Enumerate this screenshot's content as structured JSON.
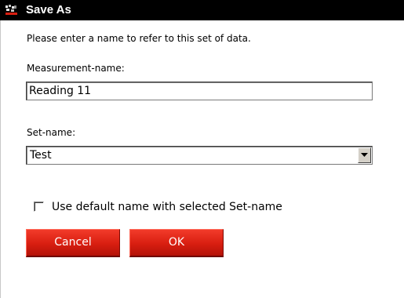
{
  "window": {
    "title": "Save As"
  },
  "dialog": {
    "instruction": "Please enter a name to refer to this set of data.",
    "measurement_label": "Measurement-name:",
    "measurement_value": "Reading 11",
    "set_label": "Set-name:",
    "set_value": "Test",
    "checkbox_label": "Use default name with selected Set-name",
    "checkbox_checked": false,
    "cancel_label": "Cancel",
    "ok_label": "OK"
  },
  "icons": {
    "app": "app-logo-icon",
    "dropdown": "triangle-down-icon"
  },
  "colors": {
    "titlebar": "#000000",
    "button": "#d81e10",
    "button_text": "#ffffff"
  }
}
